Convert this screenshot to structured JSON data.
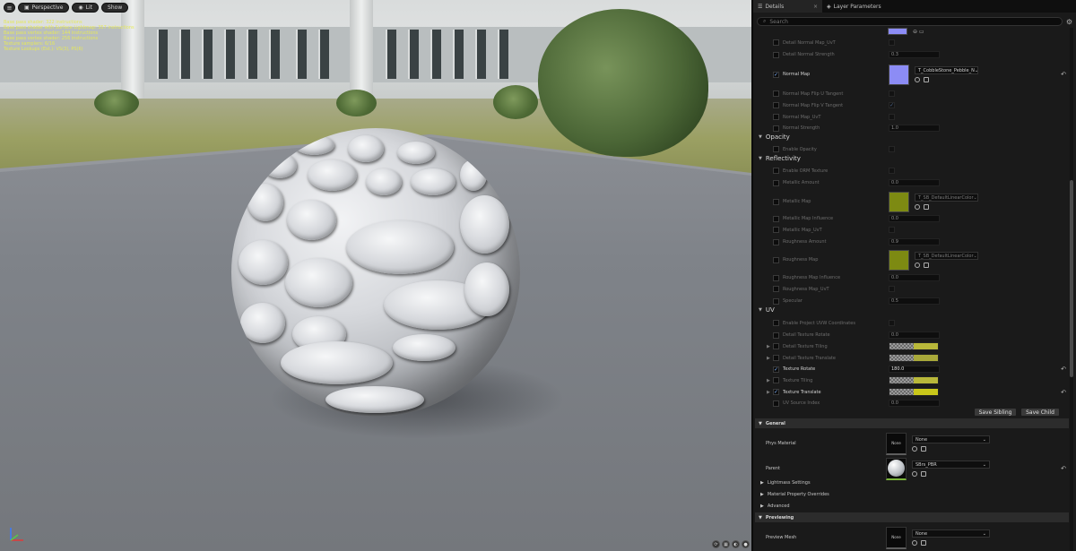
{
  "viewport": {
    "perspective_label": "Perspective",
    "lit_label": "Lit",
    "show_label": "Show",
    "stats": [
      "Base pass shader: 322 instructions",
      "Base pass shader with Surface Lightmap: 357 instructions",
      "Base pass vertex shader: 144 instructions",
      "Base pass vertex shader: 256 instructions",
      "Texture samplers: 6/16",
      "Texture Lookups (Est.): VS(3), PS(6)"
    ]
  },
  "tabs": {
    "details": "Details",
    "layer_parameters": "Layer Parameters"
  },
  "search": {
    "placeholder": "Search"
  },
  "rows": {
    "detail_normal_map_uvt": {
      "label": "Detail Normal Map_UvT"
    },
    "detail_normal_strength": {
      "label": "Detail Normal Strength",
      "value": "0.3"
    },
    "normal_map": {
      "label": "Normal Map",
      "asset": "T_CobbleStone_Pebble_N"
    },
    "normal_flip_u": {
      "label": "Normal Map Flip U Tangent"
    },
    "normal_flip_v": {
      "label": "Normal Map Flip V Tangent"
    },
    "normal_map_uvt": {
      "label": "Normal Map_UvT"
    },
    "normal_strength": {
      "label": "Normal Strength",
      "value": "1.0"
    },
    "enable_opacity": {
      "label": "Enable Opacity"
    },
    "enable_orm": {
      "label": "Enable ORM Texture"
    },
    "metallic_amount": {
      "label": "Metallic Amount",
      "value": "0.0"
    },
    "metallic_map": {
      "label": "Metallic Map",
      "asset": "T_SB_DefaultLinearColor"
    },
    "metallic_map_influence": {
      "label": "Metallic Map Influence",
      "value": "0.0"
    },
    "metallic_map_uvt": {
      "label": "Metallic Map_UvT"
    },
    "roughness_amount": {
      "label": "Roughness Amount",
      "value": "0.9"
    },
    "roughness_map": {
      "label": "Roughness Map",
      "asset": "T_SB_DefaultLinearColor"
    },
    "roughness_map_influence": {
      "label": "Roughness Map Influence",
      "value": "0.0"
    },
    "roughness_map_uvt": {
      "label": "Roughness Map_UvT"
    },
    "specular": {
      "label": "Specular",
      "value": "0.5"
    },
    "enable_project_uvw": {
      "label": "Enable Project UVW Coordinates"
    },
    "detail_texture_rotate": {
      "label": "Detail Texture Rotate",
      "value": "0.0"
    },
    "detail_texture_tiling": {
      "label": "Detail Texture Tiling"
    },
    "detail_texture_translate": {
      "label": "Detail Texture Translate"
    },
    "texture_rotate": {
      "label": "Texture Rotate",
      "value": "180.0"
    },
    "texture_tiling": {
      "label": "Texture Tiling"
    },
    "texture_translate": {
      "label": "Texture Translate"
    },
    "uv_source_index": {
      "label": "UV Source Index",
      "value": "0.0"
    }
  },
  "categories": {
    "opacity": "Opacity",
    "reflectivity": "Reflectivity",
    "uv": "UV"
  },
  "buttons": {
    "save_sibling": "Save Sibling",
    "save_child": "Save Child"
  },
  "general": {
    "header": "General",
    "phys_material_label": "Phys Material",
    "phys_material_value": "None",
    "phys_thumb": "None",
    "parent_label": "Parent",
    "parent_value": "SBrs_PBR",
    "lightmass": "Lightmass Settings",
    "overrides": "Material Property Overrides",
    "advanced": "Advanced"
  },
  "previewing": {
    "header": "Previewing",
    "preview_mesh_label": "Preview Mesh",
    "preview_mesh_value": "None",
    "preview_thumb": "None"
  },
  "colors": {
    "normal_thumb": "#8c8cf5",
    "metallic_thumb": "#7d8a12",
    "roughness_thumb": "#7d8a12",
    "tiling_yellow": "#b9b83a",
    "translate_yellow": "#c9c71a",
    "accent_blue": "#7fb3ff"
  }
}
